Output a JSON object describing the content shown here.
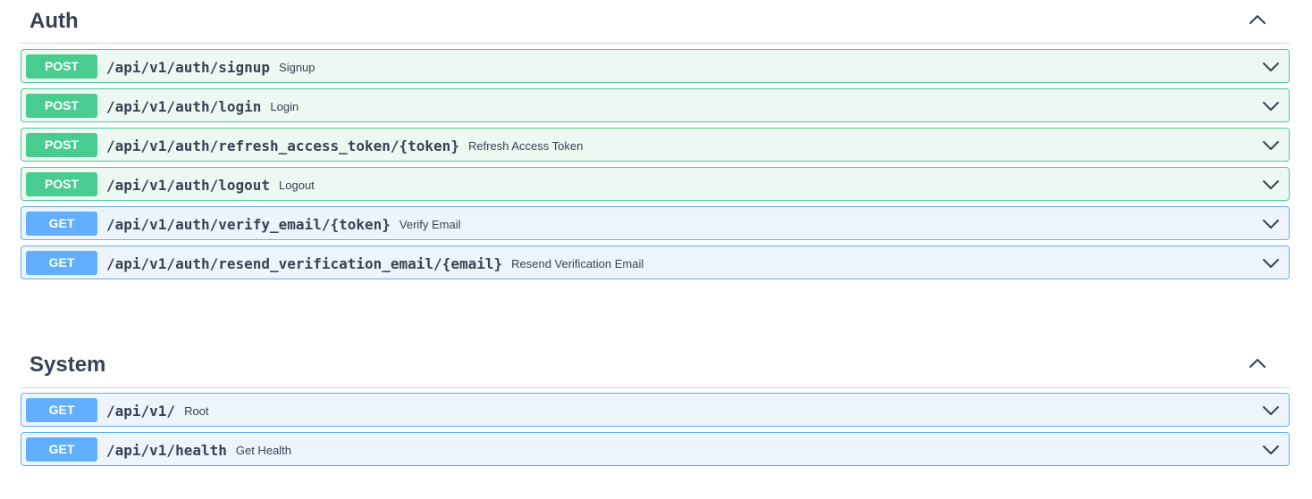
{
  "sections": [
    {
      "title": "Auth",
      "toggle_icon": "chevron-up-icon",
      "operations": [
        {
          "method": "POST",
          "path": "/api/v1/auth/signup",
          "summary": "Signup"
        },
        {
          "method": "POST",
          "path": "/api/v1/auth/login",
          "summary": "Login"
        },
        {
          "method": "POST",
          "path": "/api/v1/auth/refresh_access_token/{token}",
          "summary": "Refresh Access Token"
        },
        {
          "method": "POST",
          "path": "/api/v1/auth/logout",
          "summary": "Logout"
        },
        {
          "method": "GET",
          "path": "/api/v1/auth/verify_email/{token}",
          "summary": "Verify Email"
        },
        {
          "method": "GET",
          "path": "/api/v1/auth/resend_verification_email/{email}",
          "summary": "Resend Verification Email"
        }
      ]
    },
    {
      "title": "System",
      "toggle_icon": "chevron-up-icon",
      "operations": [
        {
          "method": "GET",
          "path": "/api/v1/",
          "summary": "Root"
        },
        {
          "method": "GET",
          "path": "/api/v1/health",
          "summary": "Get Health"
        }
      ]
    }
  ],
  "colors": {
    "post_accent": "#49cc90",
    "post_background": "#edf8f2",
    "get_accent": "#61affe",
    "get_background": "#eef4fb",
    "text": "#3b4151"
  },
  "icons": {
    "operation_toggle": "chevron-down-icon"
  }
}
